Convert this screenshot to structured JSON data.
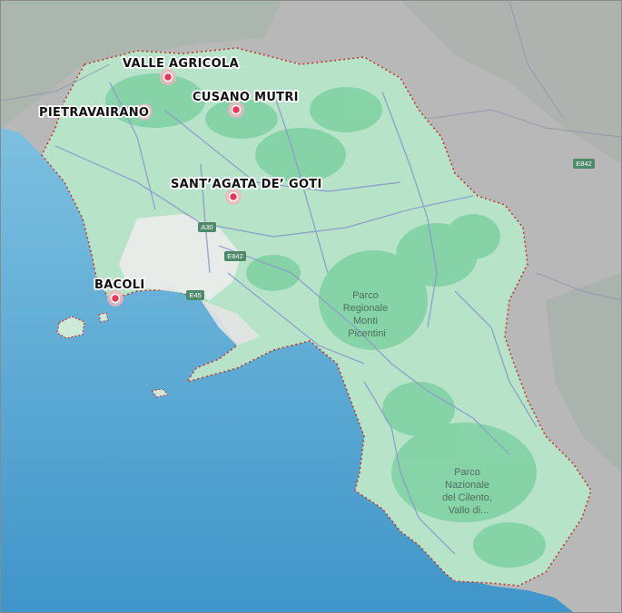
{
  "map": {
    "colors": {
      "sea": "#6cb3d9",
      "sea_deep": "#3d93c9",
      "outside_land": "#b8b8b8",
      "region_land": "#b7e4c9",
      "forest": "#7fd1a3",
      "urban": "#ececec",
      "roads": "#8a9acb",
      "border": "#c0392b",
      "marker": "#e8385a",
      "shield": "#4d8a6a"
    },
    "markers": [
      {
        "label": "VALLE AGRICOLA",
        "icon": "location-dot-icon"
      },
      {
        "label": "PIETRAVAIRANO",
        "icon": "location-dot-icon"
      },
      {
        "label": "CUSANO MUTRI",
        "icon": "location-dot-icon"
      },
      {
        "label": "SANT’AGATA DE’ GOTI",
        "icon": "location-dot-icon"
      },
      {
        "label": "BACOLI",
        "icon": "location-dot-icon"
      }
    ],
    "parks": [
      {
        "lines": [
          "Parco",
          "Regionale",
          "Monti",
          "Picentini"
        ]
      },
      {
        "lines": [
          "Parco",
          "Nazionale",
          "del Cilento,",
          "Vallo di..."
        ]
      }
    ],
    "road_shields": [
      "A30",
      "E842",
      "E45",
      "E842"
    ]
  }
}
